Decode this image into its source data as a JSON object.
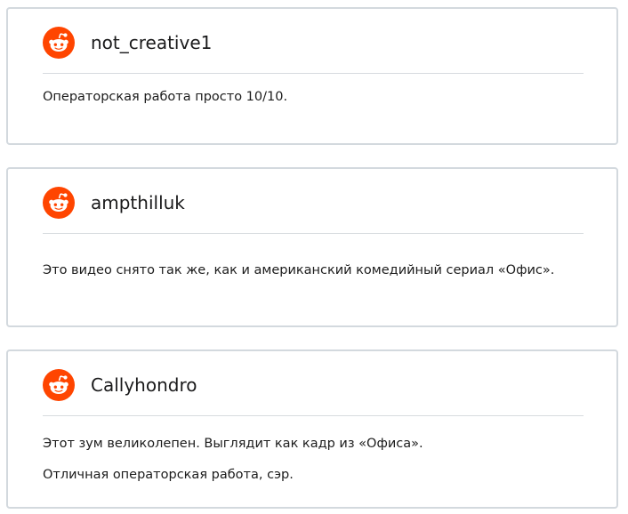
{
  "comments": [
    {
      "username": "not_creative1",
      "avatar_icon": "reddit-snoo-icon",
      "lines": [
        "Операторская работа просто 10/10."
      ]
    },
    {
      "username": "ampthilluk",
      "avatar_icon": "reddit-snoo-icon",
      "lines": [
        "Это видео снято так же, как и американский  комедийный сериал «Офис»."
      ]
    },
    {
      "username": "Callyhondro",
      "avatar_icon": "reddit-snoo-icon",
      "lines": [
        "Этот зум великолепен. Выглядит как кадр из «Офиса».",
        "Отличная операторская работа, сэр."
      ]
    }
  ],
  "colors": {
    "avatar_background": "#ff4500",
    "card_border": "#d3d9de",
    "divider": "#d7dbdf",
    "text": "#1c1c1c"
  }
}
